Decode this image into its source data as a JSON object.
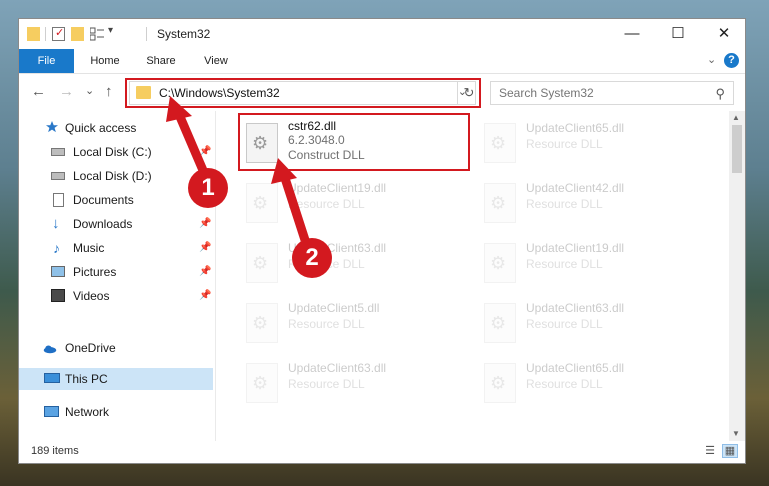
{
  "window": {
    "title": "System32",
    "minimize_glyph": "—",
    "maximize_glyph": "☐",
    "close_glyph": "✕"
  },
  "quick_access_toolbar": {
    "customize_glyph": "▾"
  },
  "ribbon": {
    "tabs": [
      {
        "label": "File"
      },
      {
        "label": "Home"
      },
      {
        "label": "Share"
      },
      {
        "label": "View"
      }
    ],
    "expand_glyph": "⌄",
    "help_glyph": "?"
  },
  "nav": {
    "back_glyph": "←",
    "forward_glyph": "→",
    "recent_glyph": "⌄",
    "up_glyph": "↑",
    "address": "C:\\Windows\\System32",
    "address_dropdown_glyph": "⌄",
    "refresh_glyph": "↻",
    "search_placeholder": "Search System32",
    "search_icon_glyph": "⚲"
  },
  "sidebar": {
    "items": [
      {
        "label": "Quick access",
        "icon": "star-icon",
        "pinned": false
      },
      {
        "label": "Local Disk (C:)",
        "icon": "drive-icon",
        "pinned": true
      },
      {
        "label": "Local Disk (D:)",
        "icon": "drive-icon",
        "pinned": false
      },
      {
        "label": "Documents",
        "icon": "documents-icon",
        "pinned": true
      },
      {
        "label": "Downloads",
        "icon": "downloads-icon",
        "pinned": true
      },
      {
        "label": "Music",
        "icon": "music-icon",
        "pinned": true
      },
      {
        "label": "Pictures",
        "icon": "pictures-icon",
        "pinned": true
      },
      {
        "label": "Videos",
        "icon": "videos-icon",
        "pinned": true
      },
      {
        "label": "OneDrive",
        "icon": "cloud-icon",
        "pinned": false
      },
      {
        "label": "This PC",
        "icon": "computer-icon",
        "pinned": false,
        "selected": true
      },
      {
        "label": "Network",
        "icon": "network-icon",
        "pinned": false
      }
    ],
    "pin_glyph": "📌"
  },
  "files": [
    {
      "name": "cstr62.dll",
      "line2": "6.2.3048.0",
      "line3": "Construct DLL",
      "highlighted": true
    },
    {
      "name": "UpdateClient65.dll",
      "line2": "Resource DLL"
    },
    {
      "name": "UpdateClient19.dll",
      "line2": "Resource DLL"
    },
    {
      "name": "UpdateClient42.dll",
      "line2": "Resource DLL"
    },
    {
      "name": "UpdateClient63.dll",
      "line2": "Resource DLL"
    },
    {
      "name": "UpdateClient19.dll",
      "line2": "Resource DLL"
    },
    {
      "name": "UpdateClient5.dll",
      "line2": "Resource DLL"
    },
    {
      "name": "UpdateClient63.dll",
      "line2": "Resource DLL"
    },
    {
      "name": "UpdateClient63.dll",
      "line2": "Resource DLL"
    },
    {
      "name": "UpdateClient65.dll",
      "line2": "Resource DLL"
    }
  ],
  "status": {
    "item_count": "189 items"
  },
  "annotations": [
    {
      "label": "1"
    },
    {
      "label": "2"
    }
  ],
  "colors": {
    "accent": "#1979ca",
    "highlight_red": "#d3191f",
    "selection": "#cce4f7",
    "folder": "#f6cd60"
  }
}
